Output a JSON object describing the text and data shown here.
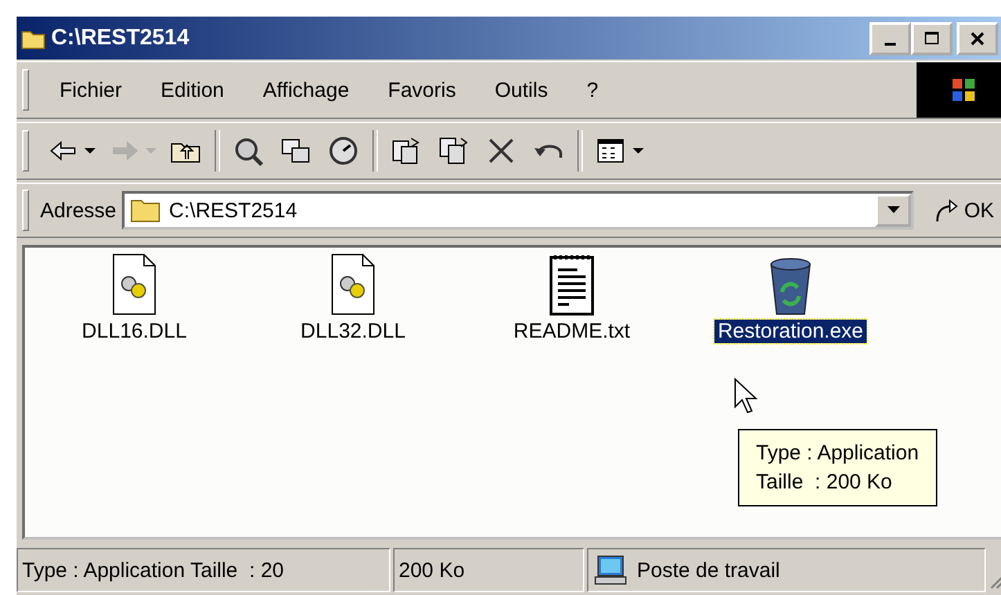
{
  "window": {
    "title": "C:\\REST2514"
  },
  "menu": [
    "Fichier",
    "Edition",
    "Affichage",
    "Favoris",
    "Outils",
    "?"
  ],
  "toolbar": [
    [
      {
        "kind": "back",
        "disabled": false,
        "dropdown": true
      },
      {
        "kind": "forward",
        "disabled": true,
        "dropdown": true
      },
      {
        "kind": "up",
        "disabled": false,
        "dropdown": false
      }
    ],
    [
      {
        "kind": "search",
        "disabled": false,
        "dropdown": false
      },
      {
        "kind": "folders",
        "disabled": false,
        "dropdown": false
      },
      {
        "kind": "history",
        "disabled": false,
        "dropdown": false
      }
    ],
    [
      {
        "kind": "move",
        "disabled": false,
        "dropdown": false
      },
      {
        "kind": "copy",
        "disabled": false,
        "dropdown": false
      },
      {
        "kind": "delete",
        "disabled": false,
        "dropdown": false
      },
      {
        "kind": "undo",
        "disabled": false,
        "dropdown": false
      }
    ],
    [
      {
        "kind": "views",
        "disabled": false,
        "dropdown": true
      }
    ]
  ],
  "address": {
    "label": "Adresse",
    "value": "C:\\REST2514",
    "go": "OK"
  },
  "files": [
    {
      "name": "DLL16.DLL",
      "kind": "dll",
      "selected": false
    },
    {
      "name": "DLL32.DLL",
      "kind": "dll",
      "selected": false
    },
    {
      "name": "README.txt",
      "kind": "txt",
      "selected": false
    },
    {
      "name": "Restoration.exe",
      "kind": "exe",
      "selected": true
    }
  ],
  "tooltip": [
    "Type : Application",
    "Taille  : 200 Ko"
  ],
  "status_bar": {
    "info": "Type : Application Taille  : 20",
    "size": "200 Ko",
    "zone": "Poste de travail"
  }
}
